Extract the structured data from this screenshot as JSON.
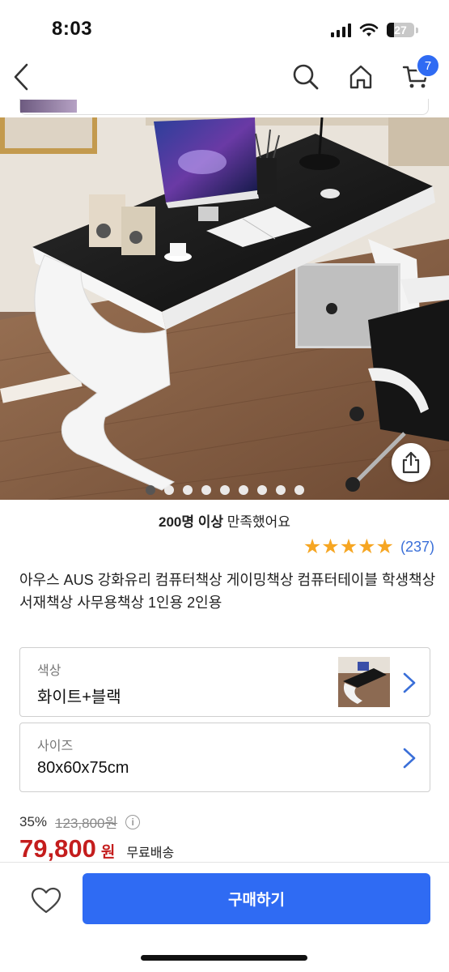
{
  "status_bar": {
    "time": "8:03",
    "battery": "27"
  },
  "nav": {
    "cart_count": "7"
  },
  "gallery": {
    "page_count": 9,
    "active_index": 0
  },
  "product": {
    "satisfaction_count": "200명 이상",
    "satisfaction_text": " 만족했어요",
    "rating": 5,
    "review_count": "(237)",
    "title": "아우스 AUS 강화유리 컴퓨터책상 게이밍책상 컴퓨터테이블 학생책상 서재책상 사무용책상 1인용 2인용"
  },
  "options": {
    "color_label": "색상",
    "color_value": "화이트+블랙",
    "size_label": "사이즈",
    "size_value": "80x60x75cm"
  },
  "price": {
    "discount": "35%",
    "original": "123,800원",
    "info_symbol": "i",
    "sale": "79,800",
    "currency": "원",
    "shipping": "무료배송"
  },
  "bottom": {
    "buy_label": "구매하기"
  },
  "colors": {
    "accent": "#2f6bf3",
    "price": "#c41d1d",
    "star": "#f6a623",
    "review": "#3a6fd8"
  }
}
